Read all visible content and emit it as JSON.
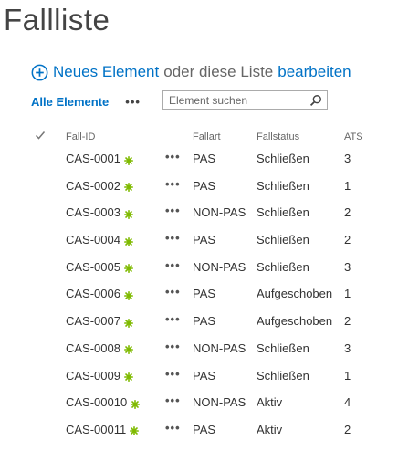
{
  "page": {
    "title": "Fallliste"
  },
  "new_item_bar": {
    "plus_icon": "plus-circle-icon",
    "new_label": "Neues Element",
    "or_text": "oder diese Liste",
    "edit_label": "bearbeiten"
  },
  "view_bar": {
    "view_label": "Alle Elemente",
    "more_label": "•••",
    "search_placeholder": "Element suchen",
    "search_icon": "magnifier-icon"
  },
  "table": {
    "check_icon": "checkmark-icon",
    "columns": {
      "id": "Fall-ID",
      "type": "Fallart",
      "status": "Fallstatus",
      "ats": "ATS"
    },
    "row_more_label": "•••",
    "new_icon": "new-item-asterisk-icon",
    "rows": [
      {
        "id": "CAS-0001",
        "type": "PAS",
        "status": "Schließen",
        "ats": "3"
      },
      {
        "id": "CAS-0002",
        "type": "PAS",
        "status": "Schließen",
        "ats": "1"
      },
      {
        "id": "CAS-0003",
        "type": "NON-PAS",
        "status": "Schließen",
        "ats": "2"
      },
      {
        "id": "CAS-0004",
        "type": "PAS",
        "status": "Schließen",
        "ats": "2"
      },
      {
        "id": "CAS-0005",
        "type": "NON-PAS",
        "status": "Schließen",
        "ats": "3"
      },
      {
        "id": "CAS-0006",
        "type": "PAS",
        "status": "Aufgeschoben",
        "ats": "1"
      },
      {
        "id": "CAS-0007",
        "type": "PAS",
        "status": "Aufgeschoben",
        "ats": "2"
      },
      {
        "id": "CAS-0008",
        "type": "NON-PAS",
        "status": "Schließen",
        "ats": "3"
      },
      {
        "id": "CAS-0009",
        "type": "PAS",
        "status": "Schließen",
        "ats": "1"
      },
      {
        "id": "CAS-00010",
        "type": "NON-PAS",
        "status": "Aktiv",
        "ats": "4"
      },
      {
        "id": "CAS-00011",
        "type": "PAS",
        "status": "Aktiv",
        "ats": "2"
      }
    ]
  },
  "colors": {
    "accent": "#0072c6",
    "new_icon": "#7fba00",
    "text": "#333333",
    "muted": "#666666"
  }
}
